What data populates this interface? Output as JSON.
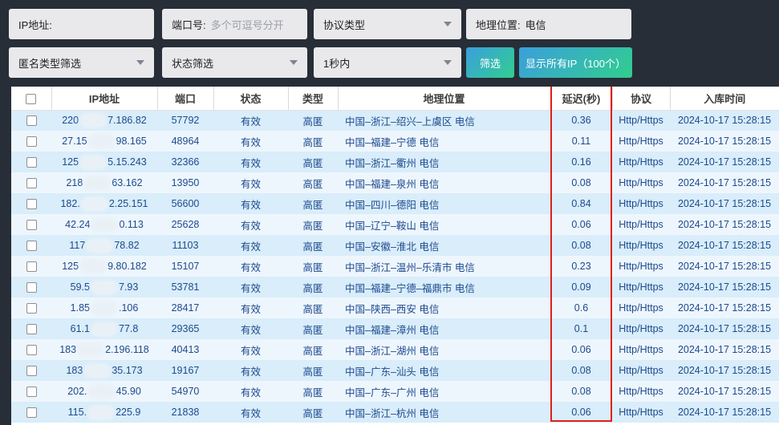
{
  "filters": {
    "ip_label": "IP地址:",
    "port_label": "端口号:",
    "port_placeholder": "多个可逗号分开",
    "protocol_select": "协议类型",
    "location_label": "地理位置:",
    "location_value": "电信",
    "anonymity_select": "匿名类型筛选",
    "status_select": "状态筛选",
    "delay_select": "1秒内",
    "filter_button": "筛选",
    "show_all_button": "显示所有IP（100个）"
  },
  "table": {
    "headers": [
      "IP地址",
      "端口",
      "状态",
      "类型",
      "地理位置",
      "延迟(秒)",
      "协议",
      "入库时间"
    ],
    "rows": [
      {
        "ip_prefix": "220",
        "ip_suffix": "7.186.82",
        "port": "57792",
        "status": "有效",
        "type": "高匿",
        "location": "中国–浙江–绍兴–上虞区 电信",
        "delay": "0.36",
        "protocol": "Http/Https",
        "time": "2024-10-17 15:28:15"
      },
      {
        "ip_prefix": "27.15",
        "ip_suffix": "98.165",
        "port": "48964",
        "status": "有效",
        "type": "高匿",
        "location": "中国–福建–宁德 电信",
        "delay": "0.11",
        "protocol": "Http/Https",
        "time": "2024-10-17 15:28:15"
      },
      {
        "ip_prefix": "125",
        "ip_suffix": "5.15.243",
        "port": "32366",
        "status": "有效",
        "type": "高匿",
        "location": "中国–浙江–衢州 电信",
        "delay": "0.16",
        "protocol": "Http/Https",
        "time": "2024-10-17 15:28:15"
      },
      {
        "ip_prefix": "218",
        "ip_suffix": "63.162",
        "port": "13950",
        "status": "有效",
        "type": "高匿",
        "location": "中国–福建–泉州 电信",
        "delay": "0.08",
        "protocol": "Http/Https",
        "time": "2024-10-17 15:28:15"
      },
      {
        "ip_prefix": "182.",
        "ip_suffix": "2.25.151",
        "port": "56600",
        "status": "有效",
        "type": "高匿",
        "location": "中国–四川–德阳 电信",
        "delay": "0.84",
        "protocol": "Http/Https",
        "time": "2024-10-17 15:28:15"
      },
      {
        "ip_prefix": "42.24",
        "ip_suffix": "0.113",
        "port": "25628",
        "status": "有效",
        "type": "高匿",
        "location": "中国–辽宁–鞍山 电信",
        "delay": "0.06",
        "protocol": "Http/Https",
        "time": "2024-10-17 15:28:15"
      },
      {
        "ip_prefix": "117",
        "ip_suffix": "78.82",
        "port": "11103",
        "status": "有效",
        "type": "高匿",
        "location": "中国–安徽–淮北 电信",
        "delay": "0.08",
        "protocol": "Http/Https",
        "time": "2024-10-17 15:28:15"
      },
      {
        "ip_prefix": "125",
        "ip_suffix": "9.80.182",
        "port": "15107",
        "status": "有效",
        "type": "高匿",
        "location": "中国–浙江–温州–乐清市 电信",
        "delay": "0.23",
        "protocol": "Http/Https",
        "time": "2024-10-17 15:28:15"
      },
      {
        "ip_prefix": "59.5",
        "ip_suffix": "7.93",
        "port": "53781",
        "status": "有效",
        "type": "高匿",
        "location": "中国–福建–宁德–福鼎市 电信",
        "delay": "0.09",
        "protocol": "Http/Https",
        "time": "2024-10-17 15:28:15"
      },
      {
        "ip_prefix": "1.85",
        "ip_suffix": ".106",
        "port": "28417",
        "status": "有效",
        "type": "高匿",
        "location": "中国–陕西–西安 电信",
        "delay": "0.6",
        "protocol": "Http/Https",
        "time": "2024-10-17 15:28:15"
      },
      {
        "ip_prefix": "61.1",
        "ip_suffix": "77.8",
        "port": "29365",
        "status": "有效",
        "type": "高匿",
        "location": "中国–福建–漳州 电信",
        "delay": "0.1",
        "protocol": "Http/Https",
        "time": "2024-10-17 15:28:15"
      },
      {
        "ip_prefix": "183",
        "ip_suffix": "2.196.118",
        "port": "40413",
        "status": "有效",
        "type": "高匿",
        "location": "中国–浙江–湖州 电信",
        "delay": "0.06",
        "protocol": "Http/Https",
        "time": "2024-10-17 15:28:15"
      },
      {
        "ip_prefix": "183",
        "ip_suffix": "35.173",
        "port": "19167",
        "status": "有效",
        "type": "高匿",
        "location": "中国–广东–汕头 电信",
        "delay": "0.08",
        "protocol": "Http/Https",
        "time": "2024-10-17 15:28:15"
      },
      {
        "ip_prefix": "202.",
        "ip_suffix": "45.90",
        "port": "54970",
        "status": "有效",
        "type": "高匿",
        "location": "中国–广东–广州 电信",
        "delay": "0.08",
        "protocol": "Http/Https",
        "time": "2024-10-17 15:28:15"
      },
      {
        "ip_prefix": "115.",
        "ip_suffix": "225.9",
        "port": "21838",
        "status": "有效",
        "type": "高匿",
        "location": "中国–浙江–杭州 电信",
        "delay": "0.06",
        "protocol": "Http/Https",
        "time": "2024-10-17 15:28:15"
      }
    ]
  },
  "colors": {
    "page_background": "#272e38",
    "button_gradient_from": "#3b9fdc",
    "button_gradient_to": "#31ce8f",
    "row_stripe_a": "#d9edfa",
    "row_stripe_b": "#eef6fd",
    "row_text": "#1c4a8e",
    "delay_highlight_red": "#e01f1a"
  }
}
